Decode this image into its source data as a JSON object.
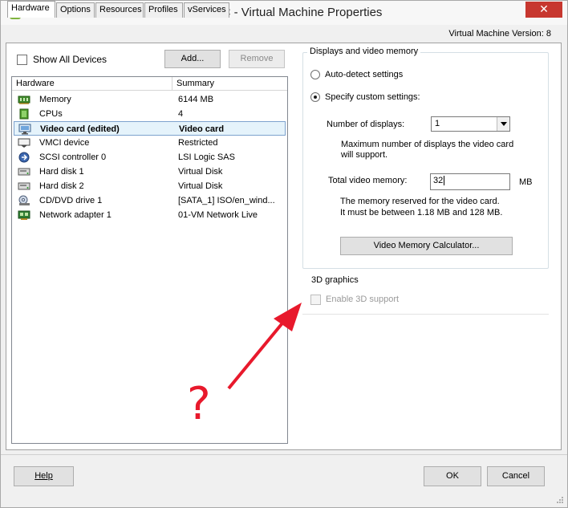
{
  "window": {
    "title": "PNL-DC - Virtual Machine Properties",
    "close_glyph": "✕",
    "version_label": "Virtual Machine Version: 8"
  },
  "tabs": [
    {
      "label": "Hardware",
      "active": true
    },
    {
      "label": "Options",
      "active": false
    },
    {
      "label": "Resources",
      "active": false
    },
    {
      "label": "Profiles",
      "active": false
    },
    {
      "label": "vServices",
      "active": false
    }
  ],
  "hardware": {
    "show_all_devices_label": "Show All Devices",
    "show_all_devices_checked": false,
    "add_button": "Add...",
    "remove_button": "Remove",
    "columns": [
      "Hardware",
      "Summary"
    ],
    "devices": [
      {
        "name": "Memory",
        "summary": "6144 MB",
        "icon": "memory-icon"
      },
      {
        "name": "CPUs",
        "summary": "4",
        "icon": "cpu-icon"
      },
      {
        "name": "Video card  (edited)",
        "summary": "Video card",
        "icon": "monitor-icon",
        "selected": true
      },
      {
        "name": "VMCI device",
        "summary": "Restricted",
        "icon": "vmci-device-icon"
      },
      {
        "name": "SCSI controller 0",
        "summary": "LSI Logic SAS",
        "icon": "scsi-controller-icon"
      },
      {
        "name": "Hard disk 1",
        "summary": "Virtual Disk",
        "icon": "hard-disk-icon"
      },
      {
        "name": "Hard disk 2",
        "summary": "Virtual Disk",
        "icon": "hard-disk-icon"
      },
      {
        "name": "CD/DVD drive 1",
        "summary": "[SATA_1] ISO/en_wind...",
        "icon": "cd-dvd-drive-icon"
      },
      {
        "name": "Network adapter 1",
        "summary": "01-VM Network Live",
        "icon": "network-adapter-icon"
      }
    ]
  },
  "displays": {
    "group_title": "Displays and video memory",
    "auto_detect_label": "Auto-detect settings",
    "custom_label": "Specify custom settings:",
    "selected_option": "custom",
    "num_displays_label": "Number of displays:",
    "num_displays_value": "1",
    "num_displays_hint": "Maximum number of displays the video card will support.",
    "total_memory_label": "Total video memory:",
    "total_memory_value": "32",
    "memory_unit": "MB",
    "memory_hint_line1": "The memory reserved for the video card.",
    "memory_hint_line2": "It must be between 1.18 MB and 128 MB.",
    "calculator_button": "Video Memory Calculator..."
  },
  "graphics3d": {
    "group_title": "3D graphics",
    "enable_label": "Enable 3D support",
    "enable_checked": false,
    "enabled": false
  },
  "annotation": {
    "text": "?",
    "color": "#e8192c"
  },
  "footer": {
    "help_button": "Help",
    "ok_button": "OK",
    "cancel_button": "Cancel"
  }
}
